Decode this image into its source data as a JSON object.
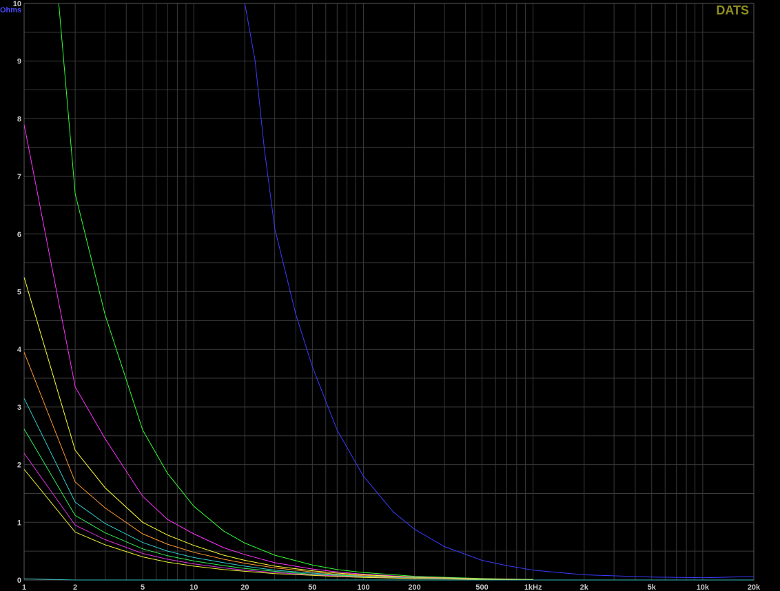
{
  "brand": "DATS",
  "chart_data": {
    "type": "line",
    "title": "",
    "xlabel": "",
    "ylabel": "Ohms",
    "x_scale": "log",
    "xlim": [
      1,
      20000
    ],
    "ylim": [
      0,
      10
    ],
    "grid": true,
    "x_tick_labels": [
      {
        "value": 1,
        "label": "1"
      },
      {
        "value": 2,
        "label": "2"
      },
      {
        "value": 5,
        "label": "5"
      },
      {
        "value": 10,
        "label": "10"
      },
      {
        "value": 20,
        "label": "20"
      },
      {
        "value": 50,
        "label": "50"
      },
      {
        "value": 100,
        "label": "100"
      },
      {
        "value": 200,
        "label": "200"
      },
      {
        "value": 500,
        "label": "500"
      },
      {
        "value": 1000,
        "label": "1kHz"
      },
      {
        "value": 2000,
        "label": "2k"
      },
      {
        "value": 5000,
        "label": "5k"
      },
      {
        "value": 10000,
        "label": "10k"
      },
      {
        "value": 20000,
        "label": "20k"
      }
    ],
    "y_tick_labels": [
      "0",
      "1",
      "2",
      "3",
      "4",
      "5",
      "6",
      "7",
      "8",
      "9",
      "10"
    ],
    "series": [
      {
        "color": "#3b3bff",
        "x": [
          20,
          23,
          26,
          30,
          40,
          50,
          70,
          100,
          150,
          200,
          300,
          500,
          700,
          1000,
          2000,
          5000,
          10000,
          20000
        ],
        "y": [
          10,
          9.0,
          7.5,
          6.1,
          4.6,
          3.7,
          2.6,
          1.8,
          1.18,
          0.88,
          0.58,
          0.34,
          0.25,
          0.17,
          0.09,
          0.05,
          0.04,
          0.06
        ]
      },
      {
        "color": "#33ff33",
        "x": [
          1.6,
          2,
          3,
          5,
          7,
          10,
          15,
          20,
          30,
          50,
          70,
          100,
          200,
          500,
          1000
        ],
        "y": [
          10,
          6.7,
          4.6,
          2.6,
          1.85,
          1.28,
          0.85,
          0.64,
          0.43,
          0.26,
          0.18,
          0.13,
          0.065,
          0.025,
          0.01
        ]
      },
      {
        "color": "#ff33ff",
        "x": [
          1,
          2,
          3,
          5,
          7,
          10,
          15,
          20,
          30,
          50,
          70,
          100,
          200,
          500,
          1000
        ],
        "y": [
          7.9,
          3.35,
          2.45,
          1.45,
          1.05,
          0.8,
          0.56,
          0.44,
          0.3,
          0.19,
          0.14,
          0.1,
          0.05,
          0.02,
          0.01
        ]
      },
      {
        "color": "#ffff33",
        "x": [
          1,
          2,
          3,
          5,
          7,
          10,
          15,
          20,
          30,
          50,
          70,
          100,
          200,
          500,
          1000
        ],
        "y": [
          5.25,
          2.25,
          1.6,
          1.0,
          0.78,
          0.6,
          0.43,
          0.34,
          0.24,
          0.16,
          0.12,
          0.09,
          0.045,
          0.02,
          0.01
        ]
      },
      {
        "color": "#ff9933",
        "x": [
          1,
          2,
          3,
          5,
          7,
          10,
          15,
          20,
          30,
          50,
          70,
          100,
          200,
          500,
          1000
        ],
        "y": [
          3.95,
          1.7,
          1.25,
          0.8,
          0.62,
          0.48,
          0.36,
          0.29,
          0.21,
          0.14,
          0.1,
          0.075,
          0.04,
          0.018,
          0.01
        ]
      },
      {
        "color": "#33cccc",
        "x": [
          1,
          2,
          3,
          5,
          7,
          10,
          15,
          20,
          30,
          50,
          70,
          100,
          200,
          500,
          1000
        ],
        "y": [
          3.15,
          1.35,
          0.98,
          0.65,
          0.5,
          0.39,
          0.3,
          0.24,
          0.17,
          0.12,
          0.09,
          0.065,
          0.035,
          0.015,
          0.008
        ]
      },
      {
        "color": "#33ee55",
        "x": [
          1,
          2,
          3,
          5,
          7,
          10,
          15,
          20,
          30,
          50,
          70,
          100,
          200,
          500,
          1000
        ],
        "y": [
          2.62,
          1.12,
          0.82,
          0.54,
          0.42,
          0.33,
          0.25,
          0.2,
          0.15,
          0.1,
          0.08,
          0.06,
          0.03,
          0.014,
          0.008
        ]
      },
      {
        "color": "#dd33dd",
        "x": [
          1,
          2,
          3,
          5,
          7,
          10,
          15,
          20,
          30,
          50,
          70,
          100,
          200,
          500,
          1000
        ],
        "y": [
          2.2,
          0.95,
          0.7,
          0.46,
          0.36,
          0.28,
          0.21,
          0.17,
          0.13,
          0.09,
          0.07,
          0.05,
          0.027,
          0.012,
          0.007
        ]
      },
      {
        "color": "#eeee33",
        "x": [
          1,
          2,
          3,
          5,
          7,
          10,
          15,
          20,
          30,
          50,
          70,
          100,
          200,
          500,
          1000
        ],
        "y": [
          1.92,
          0.83,
          0.61,
          0.4,
          0.31,
          0.24,
          0.18,
          0.15,
          0.11,
          0.08,
          0.06,
          0.045,
          0.024,
          0.011,
          0.006
        ]
      },
      {
        "color": "#33bbbb",
        "x": [
          1,
          2,
          5,
          10,
          100,
          1000,
          20000
        ],
        "y": [
          0.02,
          0.0,
          0.0,
          0.0,
          0.0,
          0.0,
          0.0
        ]
      }
    ]
  },
  "colors": {
    "background": "#000000",
    "grid": "#3a3a3a",
    "axis": "#5a5a5a",
    "tick_text": "#c8c8c8",
    "unit_text": "#4a4aff",
    "brand": "#8f8f1f"
  }
}
